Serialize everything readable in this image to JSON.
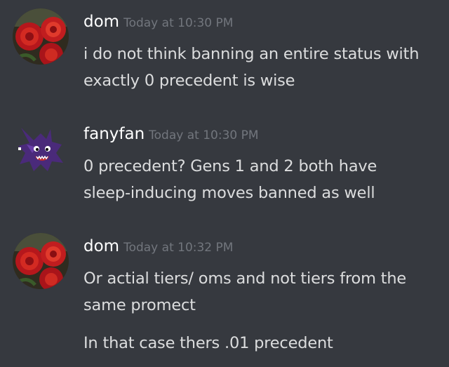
{
  "messages": [
    {
      "username": "dom",
      "timestamp": "Today at 10:30 PM",
      "avatar_icon": "red-roses-avatar",
      "lines": [
        "i do not think banning an entire status with exactly 0 precedent is wise"
      ]
    },
    {
      "username": "fanyfan",
      "timestamp": "Today at 10:30 PM",
      "avatar_icon": "purple-ghost-sprite-avatar",
      "lines": [
        "0 precedent? Gens 1 and 2 both have sleep-inducing moves banned as well"
      ]
    },
    {
      "username": "dom",
      "timestamp": "Today at 10:32 PM",
      "avatar_icon": "red-roses-avatar",
      "lines": [
        "Or actial tiers/ oms and not tiers from the same promect",
        "In that case thers .01 precedent"
      ]
    }
  ],
  "colors": {
    "background": "#36393f",
    "username": "#ffffff",
    "timestamp": "#72767d",
    "text": "#dcddde"
  }
}
